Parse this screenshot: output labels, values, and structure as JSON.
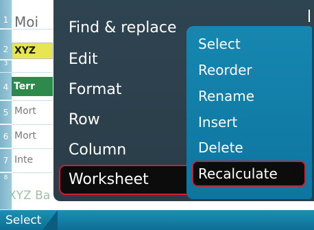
{
  "spreadsheet": {
    "rows": [
      {
        "num": "1",
        "text": "Moi"
      },
      {
        "num": "2",
        "text": "XYZ"
      },
      {
        "num": "3",
        "text": ""
      },
      {
        "num": "4",
        "text": "Terr"
      },
      {
        "num": "5",
        "text": "Mort"
      },
      {
        "num": "6",
        "text": "Mort"
      },
      {
        "num": "7",
        "text": "Inte"
      },
      {
        "num": "8",
        "text": ""
      }
    ],
    "bottom_text": "XYZ Ba"
  },
  "menu": {
    "items": [
      "Find & replace",
      "Edit",
      "Format",
      "Row",
      "Column",
      "Worksheet"
    ],
    "selected_index": 5
  },
  "submenu": {
    "items": [
      "Select",
      "Reorder",
      "Rename",
      "Insert",
      "Delete",
      "Recalculate"
    ],
    "selected_index": 5
  },
  "softkeys": {
    "left": "Select"
  },
  "colors": {
    "menu_bg": "#2f4451",
    "submenu_bg": "#1687b0",
    "highlight_border": "#d61c2b",
    "softkey_bg": "#1d8fb3",
    "row_header": "#8cc0d2"
  }
}
